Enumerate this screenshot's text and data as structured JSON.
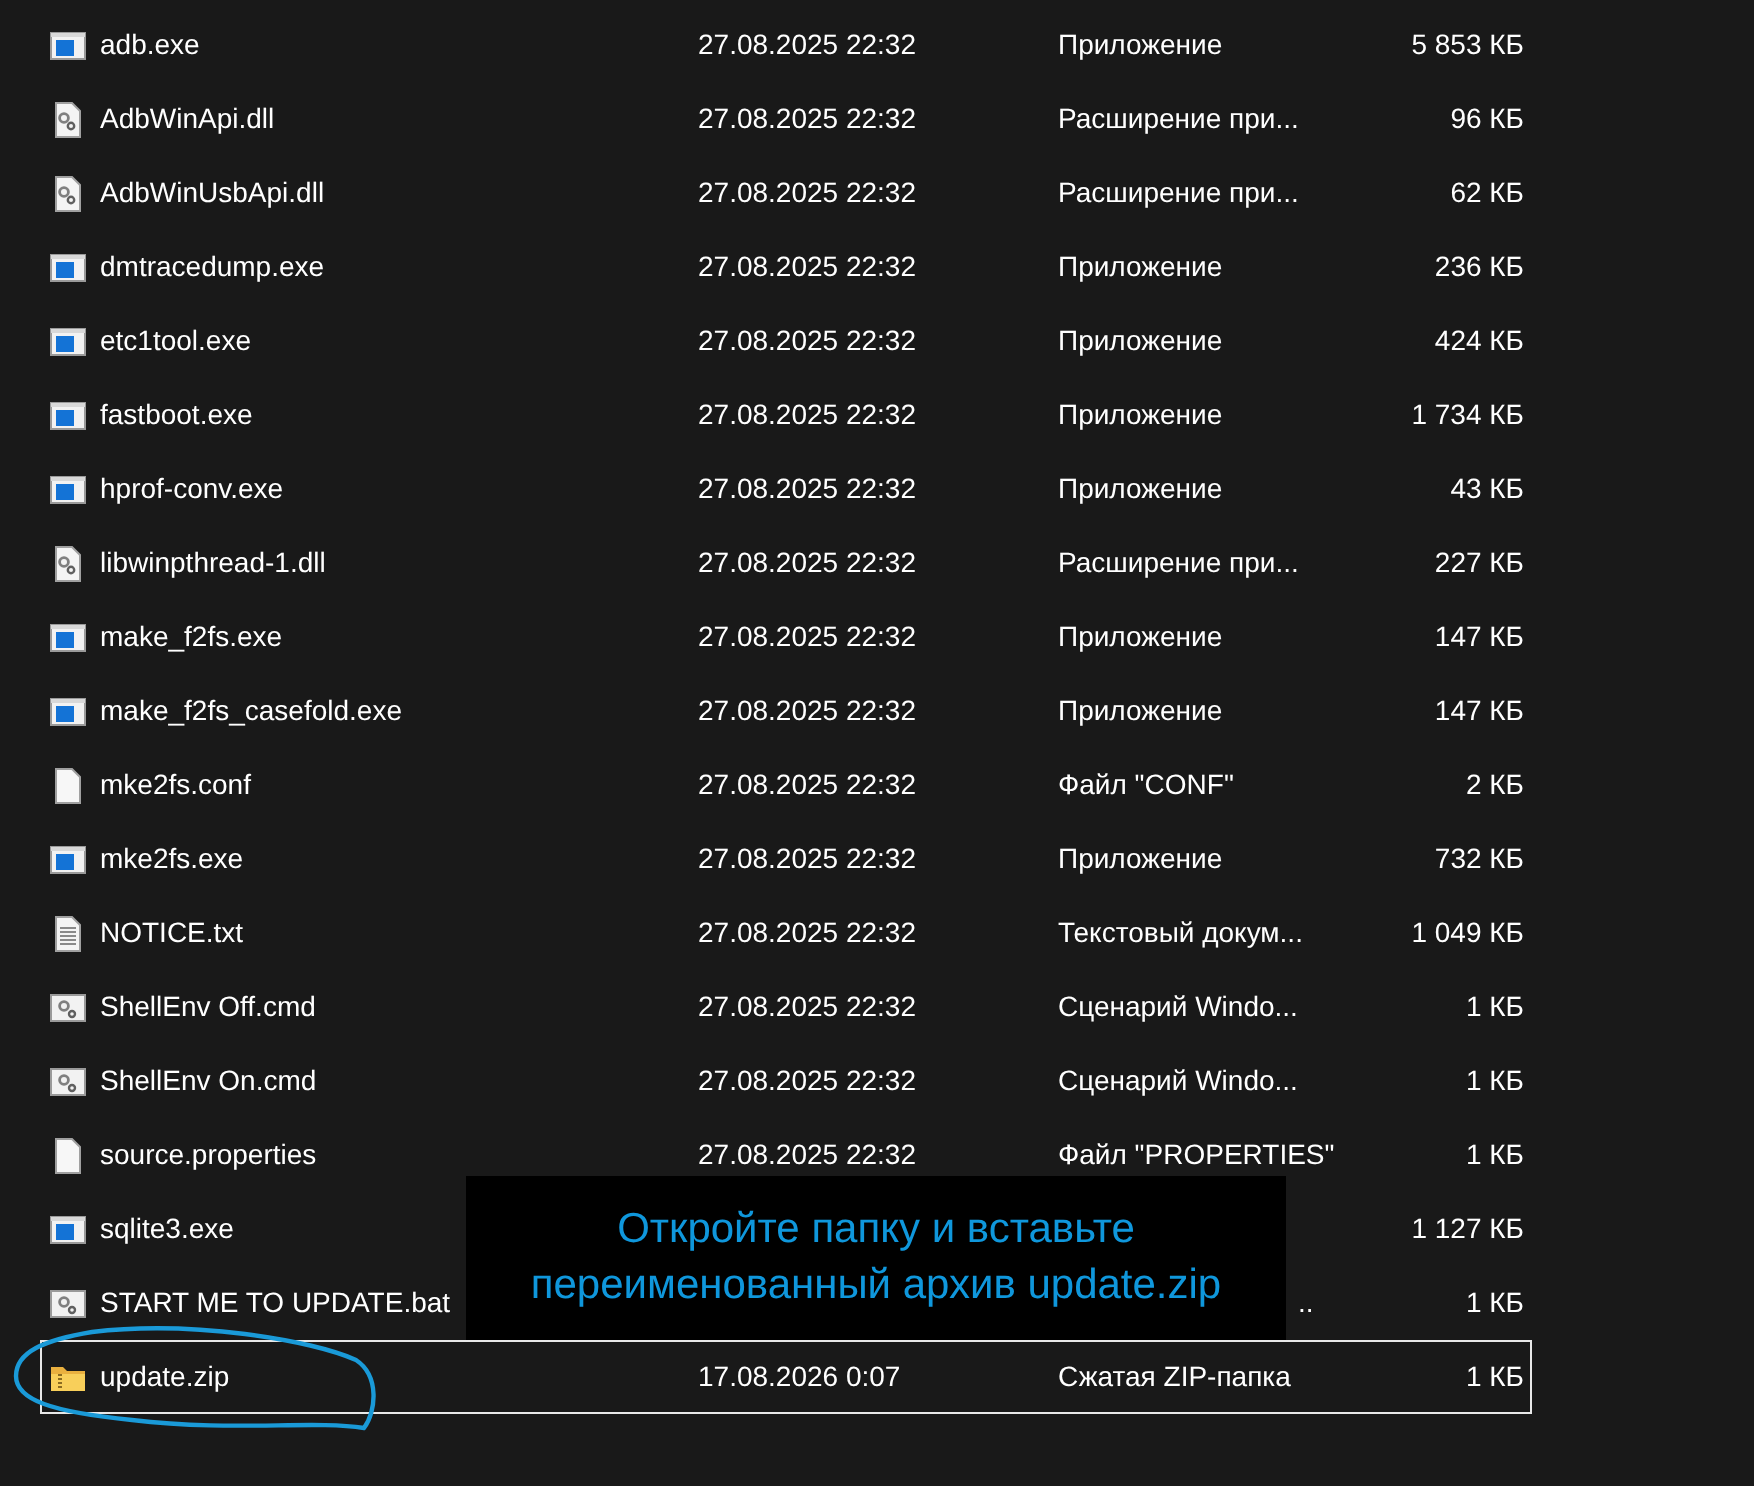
{
  "files": [
    {
      "name": "adb.exe",
      "kind": "app",
      "date": "27.08.2025 22:32",
      "type": "Приложение",
      "size": "5 853 КБ",
      "selected": false
    },
    {
      "name": "AdbWinApi.dll",
      "kind": "gear",
      "date": "27.08.2025 22:32",
      "type": "Расширение при...",
      "size": "96 КБ",
      "selected": false
    },
    {
      "name": "AdbWinUsbApi.dll",
      "kind": "gear",
      "date": "27.08.2025 22:32",
      "type": "Расширение при...",
      "size": "62 КБ",
      "selected": false
    },
    {
      "name": "dmtracedump.exe",
      "kind": "app",
      "date": "27.08.2025 22:32",
      "type": "Приложение",
      "size": "236 КБ",
      "selected": false
    },
    {
      "name": "etc1tool.exe",
      "kind": "app",
      "date": "27.08.2025 22:32",
      "type": "Приложение",
      "size": "424 КБ",
      "selected": false
    },
    {
      "name": "fastboot.exe",
      "kind": "app",
      "date": "27.08.2025 22:32",
      "type": "Приложение",
      "size": "1 734 КБ",
      "selected": false
    },
    {
      "name": "hprof-conv.exe",
      "kind": "app",
      "date": "27.08.2025 22:32",
      "type": "Приложение",
      "size": "43 КБ",
      "selected": false
    },
    {
      "name": "libwinpthread-1.dll",
      "kind": "gear",
      "date": "27.08.2025 22:32",
      "type": "Расширение при...",
      "size": "227 КБ",
      "selected": false
    },
    {
      "name": "make_f2fs.exe",
      "kind": "app",
      "date": "27.08.2025 22:32",
      "type": "Приложение",
      "size": "147 КБ",
      "selected": false
    },
    {
      "name": "make_f2fs_casefold.exe",
      "kind": "app",
      "date": "27.08.2025 22:32",
      "type": "Приложение",
      "size": "147 КБ",
      "selected": false
    },
    {
      "name": "mke2fs.conf",
      "kind": "blank",
      "date": "27.08.2025 22:32",
      "type": "Файл \"CONF\"",
      "size": "2 КБ",
      "selected": false
    },
    {
      "name": "mke2fs.exe",
      "kind": "app",
      "date": "27.08.2025 22:32",
      "type": "Приложение",
      "size": "732 КБ",
      "selected": false
    },
    {
      "name": "NOTICE.txt",
      "kind": "text",
      "date": "27.08.2025 22:32",
      "type": "Текстовый докум...",
      "size": "1 049 КБ",
      "selected": false
    },
    {
      "name": "ShellEnv Off.cmd",
      "kind": "script",
      "date": "27.08.2025 22:32",
      "type": "Сценарий Windo...",
      "size": "1 КБ",
      "selected": false
    },
    {
      "name": "ShellEnv On.cmd",
      "kind": "script",
      "date": "27.08.2025 22:32",
      "type": "Сценарий Windo...",
      "size": "1 КБ",
      "selected": false
    },
    {
      "name": "source.properties",
      "kind": "blank",
      "date": "27.08.2025 22:32",
      "type": "Файл \"PROPERTIES\"",
      "size": "1 КБ",
      "selected": false
    },
    {
      "name": "sqlite3.exe",
      "kind": "app",
      "size": "1 127 КБ",
      "selected": false
    },
    {
      "name": "START ME TO UPDATE.bat",
      "kind": "script",
      "type_tail": "..",
      "size": "1 КБ",
      "selected": false
    },
    {
      "name": "update.zip",
      "kind": "zip",
      "date": "17.08.2026 0:07",
      "type": "Сжатая ZIP-папка",
      "size": "1 КБ",
      "selected": true
    }
  ],
  "caption": {
    "lines": [
      "Откройте папку и вставьте",
      "переименованный архив update.zip"
    ]
  },
  "annotation": {
    "kind": "ellipse"
  }
}
